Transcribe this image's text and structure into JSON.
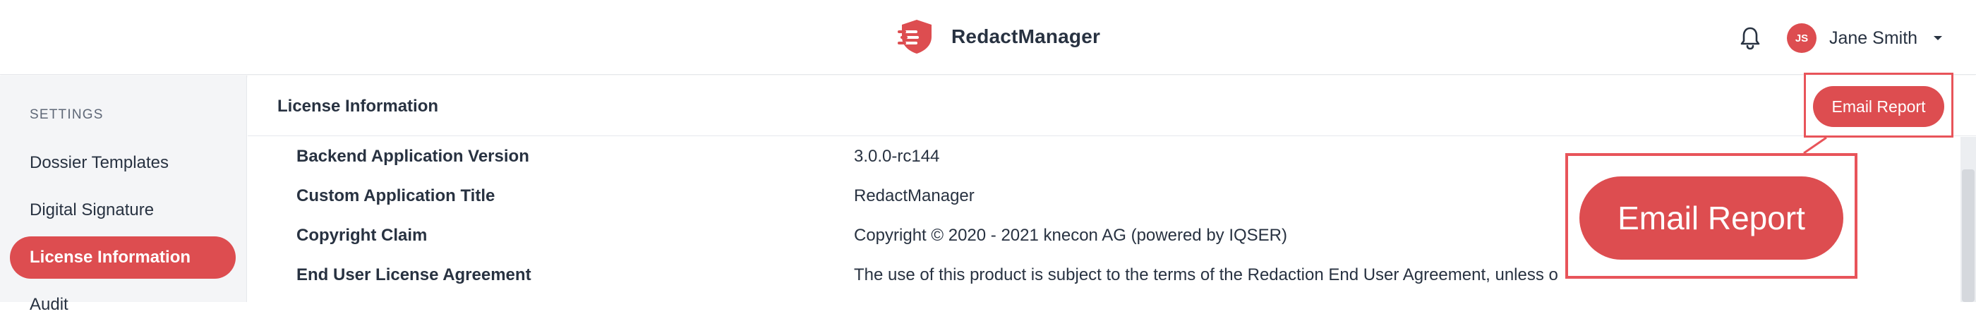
{
  "header": {
    "app_name": "RedactManager",
    "user": {
      "initials": "JS",
      "name": "Jane Smith"
    }
  },
  "sidebar": {
    "heading": "SETTINGS",
    "items": [
      {
        "label": "Dossier Templates",
        "active": false
      },
      {
        "label": "Digital Signature",
        "active": false
      },
      {
        "label": "License Information",
        "active": true
      },
      {
        "label": "Audit",
        "active": false
      }
    ]
  },
  "main": {
    "title": "License Information",
    "email_button": "Email Report",
    "rows": [
      {
        "label": "Backend Application Version",
        "value": "3.0.0-rc144"
      },
      {
        "label": "Custom Application Title",
        "value": "RedactManager"
      },
      {
        "label": "Copyright Claim",
        "value": "Copyright © 2020 - 2021 knecon AG (powered by IQSER)"
      },
      {
        "label": "End User License Agreement",
        "value": "The use of this product is subject to the terms of the Redaction End User Agreement, unless o"
      }
    ]
  },
  "zoom": {
    "label": "Email Report"
  },
  "colors": {
    "accent": "#dd4d50",
    "highlight": "#e8545a",
    "text": "#283241",
    "sidebar_bg": "#f4f5f7"
  },
  "icons": {
    "brand": "shield-logo-icon",
    "notifications": "bell-icon",
    "user_menu": "caret-down-icon"
  }
}
